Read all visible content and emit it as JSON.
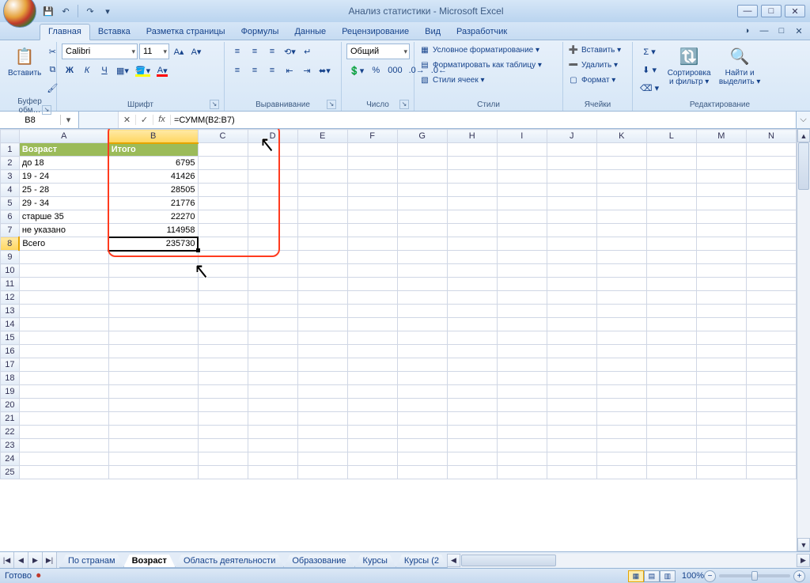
{
  "window": {
    "title": "Анализ статистики - Microsoft Excel"
  },
  "qat": {
    "save": "💾",
    "undo": "↶",
    "redo": "↷"
  },
  "tabs": [
    "Главная",
    "Вставка",
    "Разметка страницы",
    "Формулы",
    "Данные",
    "Рецензирование",
    "Вид",
    "Разработчик"
  ],
  "active_tab": 0,
  "ribbon": {
    "clipboard": {
      "caption": "Буфер обм…",
      "paste": "Вставить"
    },
    "font": {
      "caption": "Шрифт",
      "name": "Calibri",
      "size": "11",
      "bold": "Ж",
      "italic": "К",
      "underline": "Ч"
    },
    "alignment": {
      "caption": "Выравнивание"
    },
    "number": {
      "caption": "Число",
      "format": "Общий"
    },
    "styles": {
      "caption": "Стили",
      "cond": "Условное форматирование ▾",
      "table": "Форматировать как таблицу ▾",
      "cell": "Стили ячеек ▾"
    },
    "cells": {
      "caption": "Ячейки",
      "insert": "Вставить ▾",
      "delete": "Удалить ▾",
      "format": "Формат ▾"
    },
    "editing": {
      "caption": "Редактирование",
      "sort": "Сортировка\nи фильтр ▾",
      "find": "Найти и\nвыделить ▾"
    }
  },
  "formula_bar": {
    "name_box": "B8",
    "fx_label": "fx",
    "formula": "=СУММ(B2:B7)"
  },
  "columns": [
    "A",
    "B",
    "C",
    "D",
    "E",
    "F",
    "G",
    "H",
    "I",
    "J",
    "K",
    "L",
    "M",
    "N"
  ],
  "active_col": "B",
  "active_row": 8,
  "col_widths": {
    "A": 114,
    "B": 114,
    "default": 64
  },
  "visible_rows": 25,
  "headers": {
    "A": "Возраст",
    "B": "Итого"
  },
  "rows": [
    {
      "a": "до 18",
      "b": "6795"
    },
    {
      "a": "19 - 24",
      "b": "41426"
    },
    {
      "a": "25 - 28",
      "b": "28505"
    },
    {
      "a": "29 - 34",
      "b": "21776"
    },
    {
      "a": "старше 35",
      "b": "22270"
    },
    {
      "a": "не указано",
      "b": "114958"
    },
    {
      "a": "Всего",
      "b": "235730"
    }
  ],
  "sheet_tabs": [
    "По странам",
    "Возраст",
    "Область деятельности",
    "Образование",
    "Курсы",
    "Курсы (2"
  ],
  "active_sheet": 1,
  "status": {
    "ready": "Готово",
    "zoom": "100%"
  }
}
